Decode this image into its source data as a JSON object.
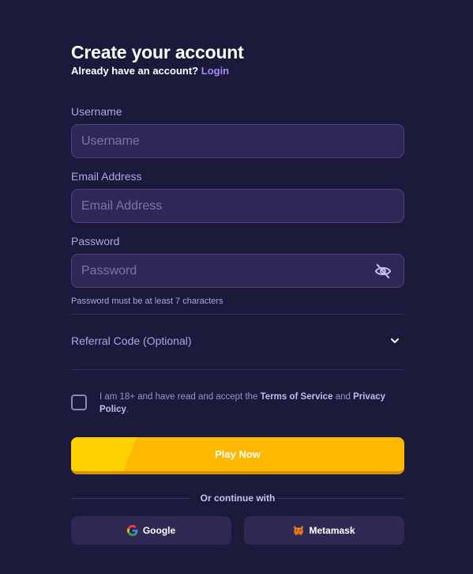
{
  "header": {
    "title": "Create your account",
    "subtitle": "Already have an account?",
    "login_link": "Login"
  },
  "fields": {
    "username": {
      "label": "Username",
      "placeholder": "Username",
      "value": ""
    },
    "email": {
      "label": "Email Address",
      "placeholder": "Email Address",
      "value": ""
    },
    "password": {
      "label": "Password",
      "placeholder": "Password",
      "value": "",
      "hint": "Password must be at least 7 characters",
      "toggle_icon": "eye-off-icon"
    }
  },
  "referral": {
    "label": "Referral Code (Optional)",
    "icon": "chevron-down-icon"
  },
  "terms": {
    "prefix": "I am 18+ and have read and accept the",
    "tos": "Terms of Service",
    "and": "and",
    "privacy": "Privacy Policy",
    "suffix": ".",
    "checked": false
  },
  "actions": {
    "play_label": "Play Now"
  },
  "divider": {
    "text": "Or continue with"
  },
  "social": [
    {
      "label": "Google",
      "icon": "google-icon"
    },
    {
      "label": "Metamask",
      "icon": "metamask-fox-icon"
    }
  ],
  "colors": {
    "background": "#1b1a3b",
    "input_bg": "#2f2857",
    "input_border": "#4c4387",
    "accent_purple": "#a987f0",
    "label": "#b3a3e3",
    "play_button": "#ffb800"
  }
}
